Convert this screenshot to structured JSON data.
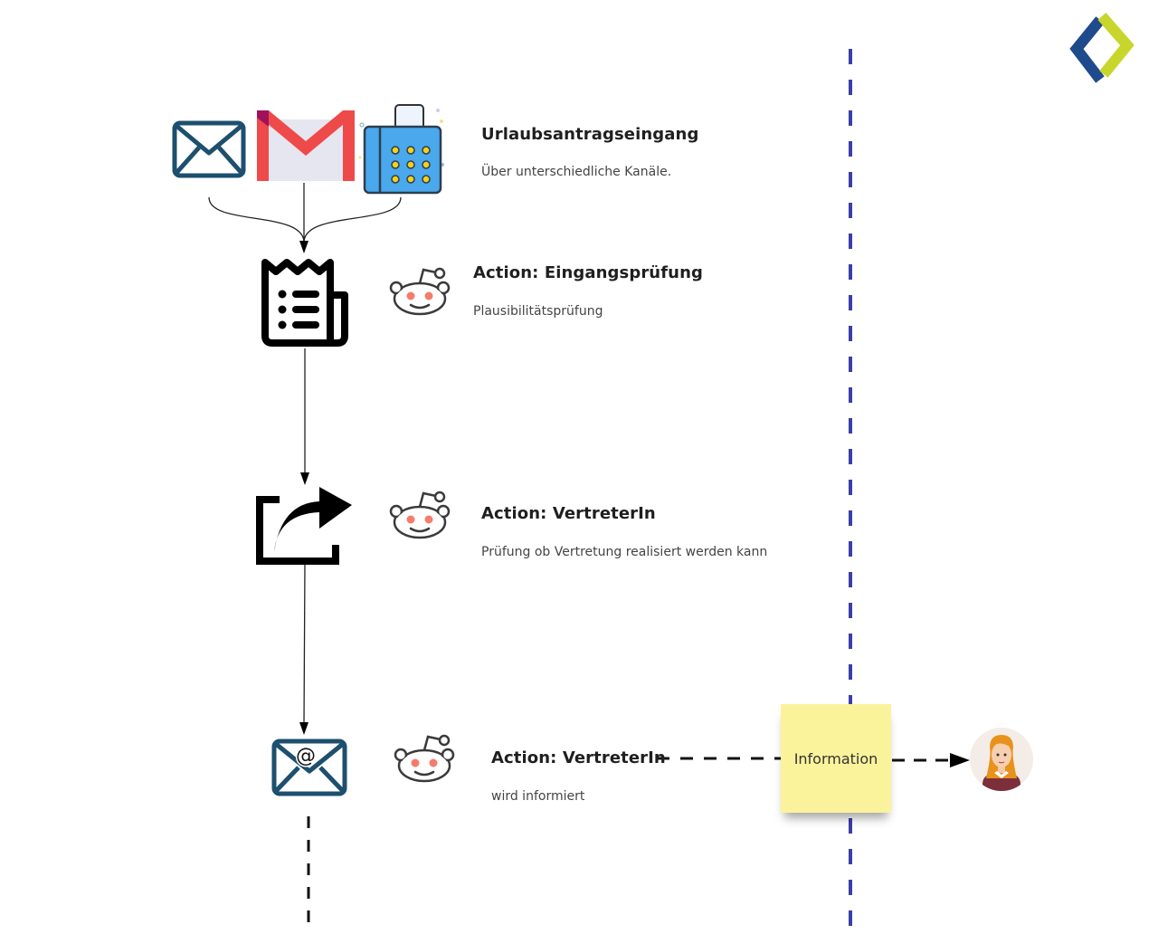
{
  "diagram": {
    "steps": [
      {
        "title": "Urlaubsantragseingang",
        "subtitle": "Über unterschiedliche Kanäle.",
        "icons": [
          "mail-envelope-icon",
          "gmail-icon",
          "fax-machine-icon"
        ]
      },
      {
        "title": "Action: Eingangsprüfung",
        "subtitle": "Plausibilitätsprüfung",
        "icons": [
          "receipt-document-icon",
          "robot-icon"
        ]
      },
      {
        "title": "Action: VertreterIn",
        "subtitle": "Prüfung ob Vertretung realisiert werden kann",
        "icons": [
          "share-forward-icon",
          "robot-icon"
        ]
      },
      {
        "title": "Action: VertreterIn",
        "subtitle": "wird informiert",
        "icons": [
          "email-at-icon",
          "robot-icon"
        ]
      }
    ],
    "sticky_note": {
      "label": "Information"
    },
    "recipient": {
      "icon": "person-avatar-icon"
    },
    "colors": {
      "swimlane_divider": "#3b3fa8",
      "logo_blue": "#1f4a8c",
      "logo_green": "#c8d62b",
      "sticky": "#fbf39c",
      "gmail_red": "#ef4a4a",
      "fax_blue": "#4aa8ec",
      "envelope_stroke": "#1d4f6e"
    }
  }
}
